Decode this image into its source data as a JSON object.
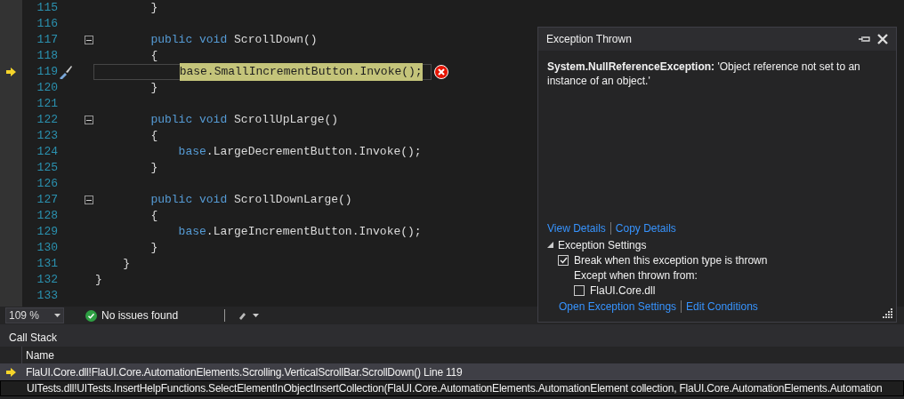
{
  "editor": {
    "lines": [
      {
        "number": "115",
        "foldable": false,
        "tokens": [
          {
            "text": "        }",
            "kind": "plain"
          }
        ]
      },
      {
        "number": "116",
        "foldable": false
      },
      {
        "number": "117",
        "foldable": true,
        "tokens": [
          {
            "text": "        public",
            "kind": "keyword"
          },
          {
            "text": " void",
            "kind": "keyword"
          },
          {
            "text": " ScrollDown()",
            "kind": "plain"
          }
        ]
      },
      {
        "number": "118",
        "foldable": false,
        "tokens": [
          {
            "text": "        {",
            "kind": "plain"
          }
        ]
      },
      {
        "number": "119",
        "foldable": false,
        "current": true,
        "error": true,
        "tokens": [
          {
            "text": "            base.SmallIncrementButton.Invoke();",
            "kind": "statement"
          }
        ]
      },
      {
        "number": "120",
        "foldable": false,
        "tokens": [
          {
            "text": "        }",
            "kind": "plain"
          }
        ]
      },
      {
        "number": "121",
        "foldable": false
      },
      {
        "number": "122",
        "foldable": true,
        "tokens": [
          {
            "text": "        public",
            "kind": "keyword"
          },
          {
            "text": " void",
            "kind": "keyword"
          },
          {
            "text": " ScrollUpLarge()",
            "kind": "plain"
          }
        ]
      },
      {
        "number": "123",
        "foldable": false,
        "tokens": [
          {
            "text": "        {",
            "kind": "plain"
          }
        ]
      },
      {
        "number": "124",
        "foldable": false,
        "tokens": [
          {
            "text": "            base",
            "kind": "keyword"
          },
          {
            "text": ".LargeDecrementButton.Invoke();",
            "kind": "plain"
          }
        ]
      },
      {
        "number": "125",
        "foldable": false,
        "tokens": [
          {
            "text": "        }",
            "kind": "plain"
          }
        ]
      },
      {
        "number": "126",
        "foldable": false
      },
      {
        "number": "127",
        "foldable": true,
        "tokens": [
          {
            "text": "        public",
            "kind": "keyword"
          },
          {
            "text": " void",
            "kind": "keyword"
          },
          {
            "text": " ScrollDownLarge()",
            "kind": "plain"
          }
        ]
      },
      {
        "number": "128",
        "foldable": false,
        "tokens": [
          {
            "text": "        {",
            "kind": "plain"
          }
        ]
      },
      {
        "number": "129",
        "foldable": false,
        "tokens": [
          {
            "text": "            base",
            "kind": "keyword"
          },
          {
            "text": ".LargeIncrementButton.Invoke();",
            "kind": "plain"
          }
        ]
      },
      {
        "number": "130",
        "foldable": false,
        "tokens": [
          {
            "text": "        }",
            "kind": "plain"
          }
        ]
      },
      {
        "number": "131",
        "foldable": false,
        "tokens": [
          {
            "text": "    }",
            "kind": "plain"
          }
        ]
      },
      {
        "number": "132",
        "foldable": false,
        "tokens": [
          {
            "text": "}",
            "kind": "plain"
          }
        ]
      },
      {
        "number": "133",
        "foldable": false
      }
    ]
  },
  "status_bar": {
    "zoom": "109 %",
    "issues": "No issues found"
  },
  "exception_popup": {
    "title": "Exception Thrown",
    "message": "**System.NullReferenceException:** 'Object reference not set to an instance of an object.'",
    "links": [
      "View Details",
      "Copy Details"
    ],
    "settings": {
      "title": "Exception Settings",
      "expanded": true,
      "break_option": {
        "label": "Break when this exception type is thrown",
        "checked": true
      },
      "except_label": "Except when thrown from:",
      "except_option": {
        "label": "FlaUI.Core.dll",
        "checked": false
      }
    },
    "bottom_links": [
      "Open Exception Settings",
      "Edit Conditions"
    ]
  },
  "call_stack": {
    "title": "Call Stack",
    "columns": [
      "Name"
    ],
    "rows": [
      {
        "name": "FlaUI.Core.dll!FlaUI.Core.AutomationElements.Scrolling.VerticalScrollBar.ScrollDown() Line 119",
        "current": true,
        "selected": true
      },
      {
        "name": "UITests.dll!UITests.InsertHelpFunctions.SelectElementInObjectInsertCollection(FlaUI.Core.AutomationElements.AutomationElement collection, FlaUI.Core.AutomationElements.Automation",
        "current": false,
        "selected": false
      }
    ]
  }
}
